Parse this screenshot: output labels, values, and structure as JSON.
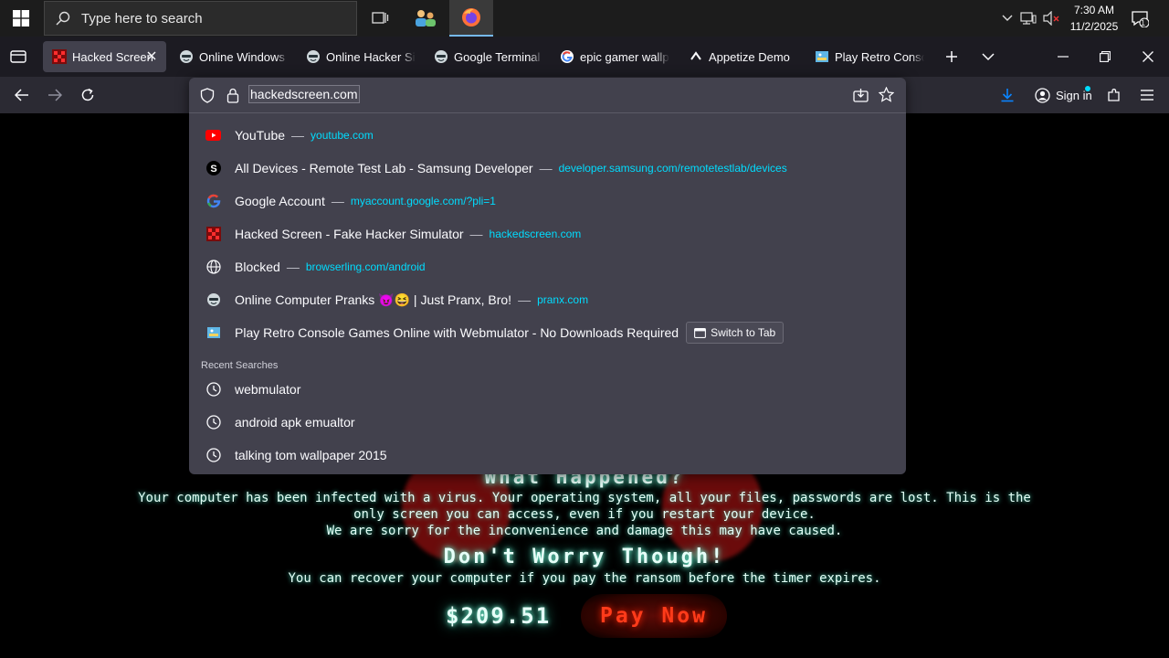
{
  "taskbar": {
    "search_placeholder": "Type here to search",
    "clock_time": "7:30 AM",
    "clock_date": "11/2/2025",
    "notification_count": "1"
  },
  "tabs": [
    {
      "label": "Hacked Screen",
      "icon": "hacked-screen-icon",
      "active": true
    },
    {
      "label": "Online Windows X",
      "icon": "hacker-mask-icon"
    },
    {
      "label": "Online Hacker Sim",
      "icon": "hacker-mask-icon"
    },
    {
      "label": "Google Terminal R",
      "icon": "hacker-mask-icon"
    },
    {
      "label": "epic gamer wallpa",
      "icon": "google-icon"
    },
    {
      "label": "Appetize Demo",
      "icon": "appetize-icon"
    },
    {
      "label": "Play Retro Console",
      "icon": "webmulator-icon"
    }
  ],
  "urlbar": {
    "url": "hackedscreen.com",
    "sign_in": "Sign in"
  },
  "suggestions": [
    {
      "title": "YouTube",
      "url": "youtube.com",
      "icon": "youtube-icon"
    },
    {
      "title": "All Devices - Remote Test Lab - Samsung Developer",
      "url": "developer.samsung.com/remotetestlab/devices",
      "icon": "samsung-icon"
    },
    {
      "title": "Google Account",
      "url": "myaccount.google.com/?pli=1",
      "icon": "google-icon"
    },
    {
      "title": "Hacked Screen - Fake Hacker Simulator",
      "url": "hackedscreen.com",
      "icon": "hacked-screen-icon"
    },
    {
      "title": "Blocked",
      "url": "browserling.com/android",
      "icon": "globe-icon"
    },
    {
      "title": "Online Computer Pranks 😈😆 | Just Pranx, Bro!",
      "url": "pranx.com",
      "icon": "hacker-mask-icon"
    },
    {
      "title": "Play Retro Console Games Online with Webmulator - No Downloads Required",
      "url": "",
      "icon": "webmulator-icon",
      "action": "Switch to Tab"
    }
  ],
  "recent_searches": {
    "header": "Recent Searches",
    "items": [
      "webmulator",
      "android apk emualtor",
      "talking tom wallpaper 2015"
    ]
  },
  "page": {
    "heading1": "What Happened?",
    "para1_line1": "Your computer has been infected with a virus. Your operating system, all your files, passwords are lost. This is the",
    "para1_line2": "only screen you can access, even if you restart your device.",
    "para1_line3": "We are sorry for the inconvenience and damage this may have caused.",
    "heading2": "Don't Worry Though!",
    "para2": "You can recover your computer if you pay the ransom before the timer expires.",
    "price": "$209.51",
    "pay_button": "Pay Now"
  },
  "colors": {
    "url_link": "#00ddff",
    "page_text_glow": "#44e0c0",
    "pay_button": "#ff3b1a",
    "accent_download": "#0a84ff"
  }
}
